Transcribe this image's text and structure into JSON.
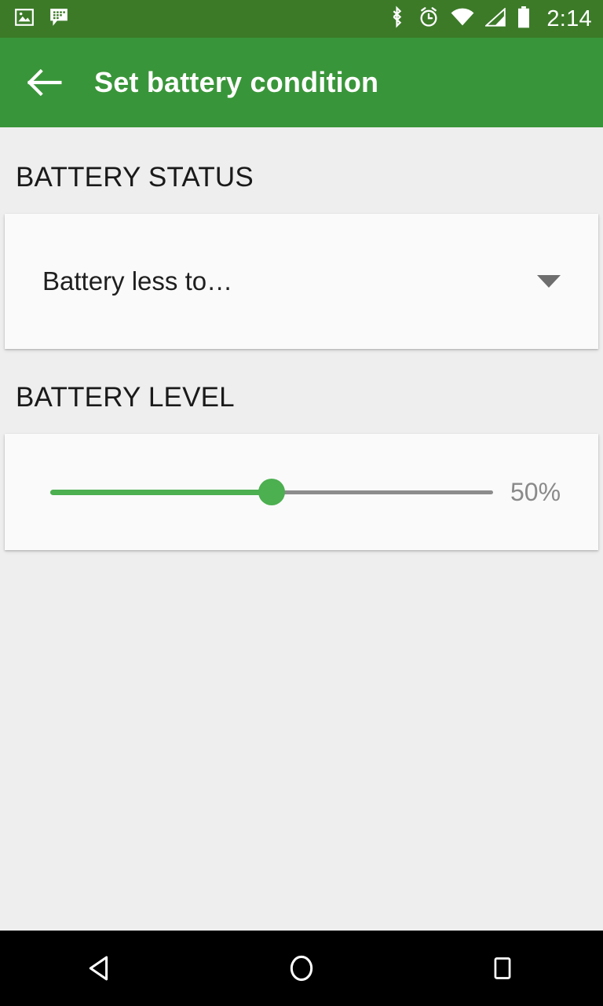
{
  "status_bar": {
    "left_icons": [
      "photo-icon",
      "bbm-chat-icon"
    ],
    "right_icons": [
      "bluetooth-icon",
      "alarm-icon",
      "wifi-icon",
      "cell-signal-icon",
      "battery-icon"
    ],
    "time": "2:14",
    "background_color": "#3C7A28"
  },
  "app_bar": {
    "back_icon": "back-arrow-icon",
    "title": "Set battery condition",
    "background_color": "#399539",
    "text_color": "#FFFFFF"
  },
  "sections": {
    "battery_status": {
      "header": "BATTERY STATUS",
      "dropdown": {
        "value": "Battery less to…",
        "caret_icon": "chevron-down-icon"
      }
    },
    "battery_level": {
      "header": "BATTERY LEVEL",
      "slider": {
        "value_label": "50%",
        "value": 50,
        "min": 0,
        "max": 100,
        "active_color": "#4CAF50",
        "inactive_color": "#8C8C8C"
      }
    }
  },
  "nav_bar": {
    "back": "nav-back-icon",
    "home": "nav-home-icon",
    "recents": "nav-recents-icon"
  }
}
